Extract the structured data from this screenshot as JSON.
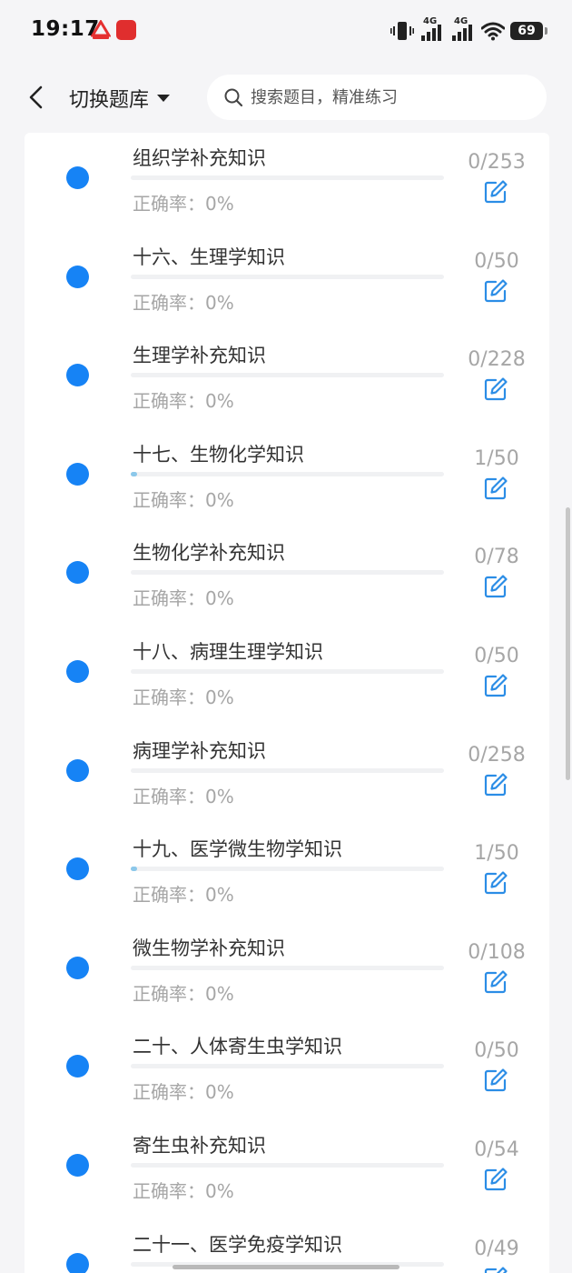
{
  "status_bar": {
    "time": "19:17",
    "network_1": "4G",
    "network_2": "4G",
    "battery": "69",
    "icons": [
      "vibrate-icon",
      "signal-icon",
      "wifi-icon",
      "battery-icon"
    ]
  },
  "header": {
    "switch_label": "切换题库",
    "search_placeholder": "搜索题目，精准练习"
  },
  "colors": {
    "accent": "#1683f5",
    "progress_fill": "#8cc8ea",
    "muted_text": "#a6a6a6",
    "edit_icon": "#2b8de6"
  },
  "items": [
    {
      "title": "组织学补充知识",
      "accuracy": "正确率：0%",
      "count": "0/253",
      "progress": 0
    },
    {
      "title": "十六、生理学知识",
      "accuracy": "正确率：0%",
      "count": "0/50",
      "progress": 0
    },
    {
      "title": "生理学补充知识",
      "accuracy": "正确率：0%",
      "count": "0/228",
      "progress": 0
    },
    {
      "title": "十七、生物化学知识",
      "accuracy": "正确率：0%",
      "count": "1/50",
      "progress": 0.02
    },
    {
      "title": "生物化学补充知识",
      "accuracy": "正确率：0%",
      "count": "0/78",
      "progress": 0
    },
    {
      "title": "十八、病理生理学知识",
      "accuracy": "正确率：0%",
      "count": "0/50",
      "progress": 0
    },
    {
      "title": "病理学补充知识",
      "accuracy": "正确率：0%",
      "count": "0/258",
      "progress": 0
    },
    {
      "title": "十九、医学微生物学知识",
      "accuracy": "正确率：0%",
      "count": "1/50",
      "progress": 0.02
    },
    {
      "title": "微生物学补充知识",
      "accuracy": "正确率：0%",
      "count": "0/108",
      "progress": 0
    },
    {
      "title": "二十、人体寄生虫学知识",
      "accuracy": "正确率：0%",
      "count": "0/50",
      "progress": 0
    },
    {
      "title": "寄生虫补充知识",
      "accuracy": "正确率：0%",
      "count": "0/54",
      "progress": 0
    },
    {
      "title": "二十一、医学免疫学知识",
      "accuracy": "",
      "count": "0/49",
      "progress": 0
    }
  ]
}
